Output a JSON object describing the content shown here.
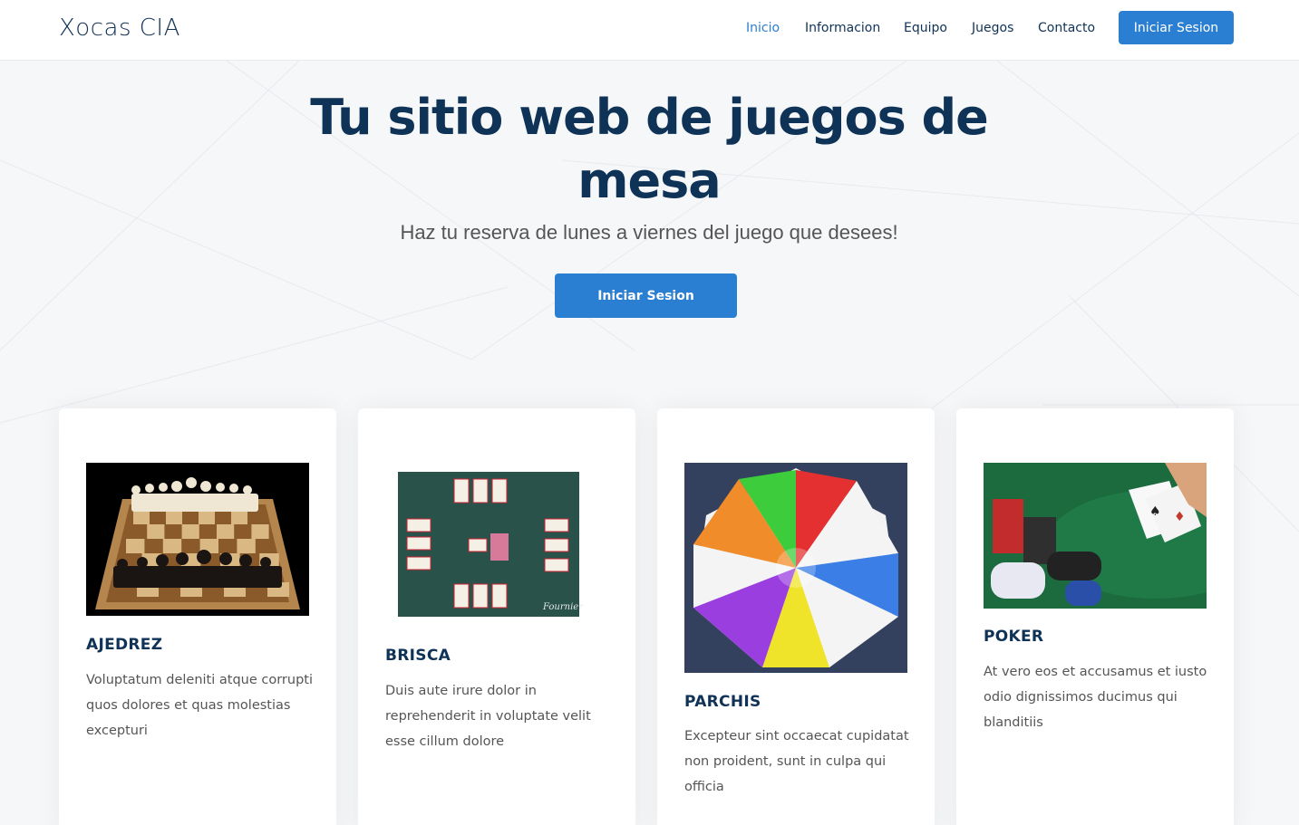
{
  "header": {
    "logo": "Xocas CIA",
    "nav": [
      "Inicio",
      "Informacion",
      "Equipo",
      "Juegos",
      "Contacto"
    ],
    "active_nav": "Inicio",
    "cta": "Iniciar Sesion"
  },
  "hero": {
    "title": "Tu sitio web de juegos de mesa",
    "subtitle": "Haz tu reserva de lunes a viernes del juego que desees!",
    "cta": "Iniciar Sesion"
  },
  "cards": [
    {
      "title": "AJEDREZ",
      "desc": "Voluptatum deleniti atque corrupti quos dolores et quas molestias excepturi",
      "image": "chess-board-image"
    },
    {
      "title": "BRISCA",
      "desc": "Duis aute irure dolor in reprehenderit in voluptate velit esse cillum dolore",
      "image": "spanish-cards-image"
    },
    {
      "title": "PARCHIS",
      "desc": "Excepteur sint occaecat cupidatat non proident, sunt in culpa qui officia",
      "image": "parchis-board-image"
    },
    {
      "title": "POKER",
      "desc": "At vero eos et accusamus et iusto odio dignissimos ducimus qui blanditiis",
      "image": "poker-chips-image"
    }
  ],
  "image_text": {
    "brisca_brand": "Fournier"
  },
  "colors": {
    "primary": "#2b7fd2",
    "navy": "#0f3257"
  }
}
